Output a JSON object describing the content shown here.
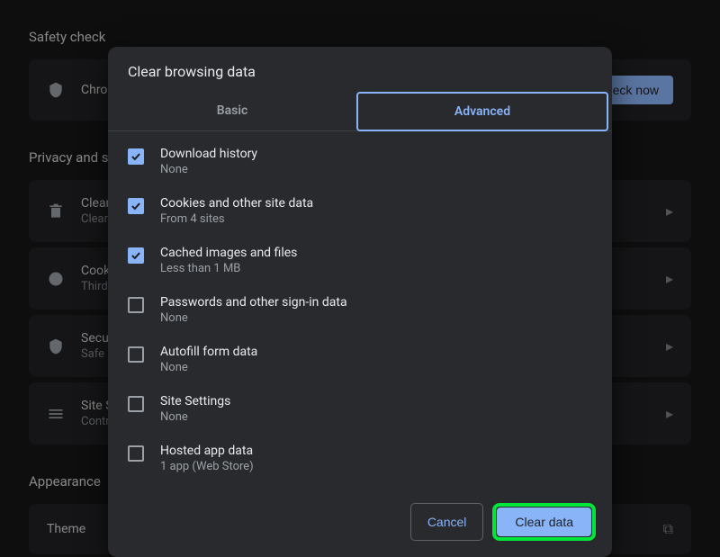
{
  "background": {
    "safety_title": "Safety check",
    "safety_sub": "Chrome",
    "check_now": "Check now",
    "privacy_title": "Privacy and security",
    "rows": [
      {
        "title": "Clear browsing data",
        "sub": "Clear history, cookies, cache, and more"
      },
      {
        "title": "Cookies and other site data",
        "sub": "Third-party cookies are blocked in Incognito mode"
      },
      {
        "title": "Security",
        "sub": "Safe Browsing (protection from dangerous sites) and other security settings"
      },
      {
        "title": "Site Settings",
        "sub": "Controls what information sites can use and show"
      }
    ],
    "appearance_title": "Appearance",
    "theme": "Theme"
  },
  "dialog": {
    "title": "Clear browsing data",
    "tab_basic": "Basic",
    "tab_advanced": "Advanced",
    "items": [
      {
        "label": "Download history",
        "sub": "None",
        "checked": true
      },
      {
        "label": "Cookies and other site data",
        "sub": "From 4 sites",
        "checked": true
      },
      {
        "label": "Cached images and files",
        "sub": "Less than 1 MB",
        "checked": true
      },
      {
        "label": "Passwords and other sign-in data",
        "sub": "None",
        "checked": false
      },
      {
        "label": "Autofill form data",
        "sub": "None",
        "checked": false
      },
      {
        "label": "Site Settings",
        "sub": "None",
        "checked": false
      },
      {
        "label": "Hosted app data",
        "sub": "1 app (Web Store)",
        "checked": false
      }
    ],
    "cancel": "Cancel",
    "clear": "Clear data"
  }
}
